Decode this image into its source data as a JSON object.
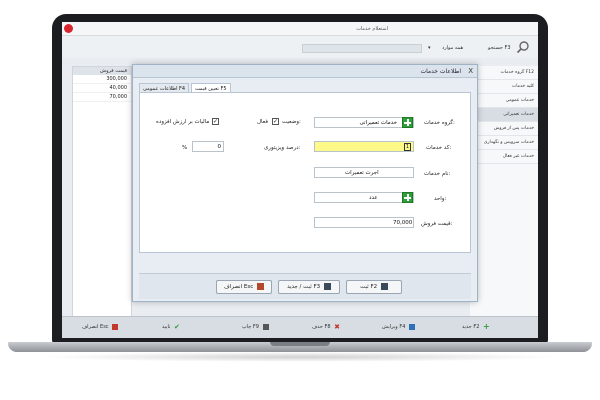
{
  "app": {
    "title": "استعلام خدمات",
    "search_label": "جستجو F3",
    "search_mode": "همه موارد",
    "grid_header": "قیمت فروش",
    "grid_rows": [
      "300,000",
      "40,000",
      "70,000"
    ]
  },
  "sidebar": {
    "items": [
      {
        "label": "گروه خدمات F12"
      },
      {
        "label": "کلیه خدمات"
      },
      {
        "label": "خدمات عمومی"
      },
      {
        "label": "خدمات تعمیراتی"
      },
      {
        "label": "خدمات پس از فروش"
      },
      {
        "label": "خدمات سرویس و نگهداری"
      },
      {
        "label": "خدمات غیر فعال"
      }
    ]
  },
  "bottombar": {
    "new": "جدید F2",
    "edit": "ویرایش F4",
    "delete": "حذف F8",
    "print": "چاپ F9",
    "confirm": "تایید",
    "cancel": "انصراف Esc"
  },
  "modal": {
    "title": "اطلاعات خدمات",
    "close": "X",
    "tabs": [
      "اطلاعات عمومی F4",
      "تعیین قیمت F5"
    ],
    "fields": {
      "group_label": "گروه خدمات:",
      "group_value": "خدمات تعمیراتی",
      "status_label": "وضعیت:",
      "status_value": "فعال",
      "vat_label": "مالیات بر ارزش افزوده",
      "code_label": "کد خدمات:",
      "code_value": "1",
      "visit_pct_label": "درصد ویزیتوری:",
      "visit_pct_value": "0",
      "pct_sign": "%",
      "name_label": "نام خدمات:",
      "name_value": "اجرت تعمیرات",
      "unit_label": "واحد:",
      "unit_value": "عدد",
      "price_label": "قیمت فروش:",
      "price_value": "70,000"
    },
    "buttons": {
      "save": "ثبت F2",
      "save_new": "ثبت / جدید F3",
      "cancel": "انصراف Esc"
    }
  },
  "colors": {
    "accent_green": "#2f9e39",
    "highlight_yellow": "#fff98a",
    "close_red": "#d8262e"
  }
}
